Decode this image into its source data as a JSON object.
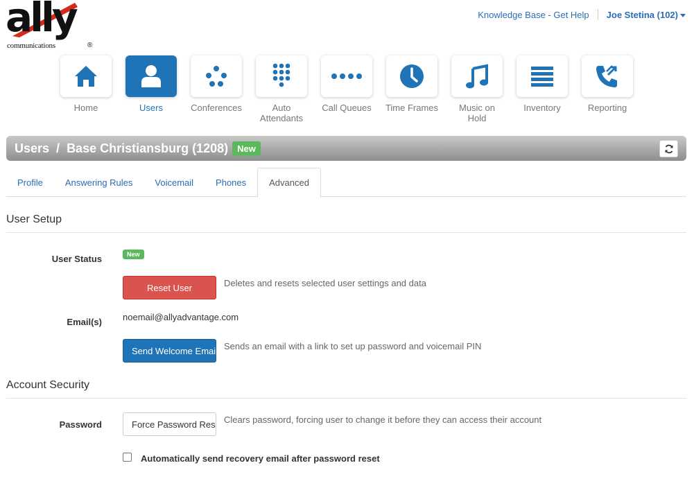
{
  "logo": {
    "main": "ally",
    "sub": "communications",
    "reg": "®"
  },
  "topbar": {
    "kb_link": "Knowledge Base - Get Help",
    "user": "Joe Stetina (102)"
  },
  "nav": [
    {
      "label": "Home",
      "icon": "home-icon"
    },
    {
      "label": "Users",
      "icon": "user-icon"
    },
    {
      "label": "Conferences",
      "icon": "conference-icon"
    },
    {
      "label": "Auto\nAttendants",
      "icon": "keypad-icon"
    },
    {
      "label": "Call Queues",
      "icon": "dots-icon"
    },
    {
      "label": "Time Frames",
      "icon": "clock-icon"
    },
    {
      "label": "Music on\nHold",
      "icon": "music-icon"
    },
    {
      "label": "Inventory",
      "icon": "list-icon"
    },
    {
      "label": "Reporting",
      "icon": "phone-report-icon"
    }
  ],
  "titlebar": {
    "section": "Users",
    "separator": "/",
    "name": "Base Christiansburg (1208)",
    "badge": "New"
  },
  "tabs": [
    "Profile",
    "Answering Rules",
    "Voicemail",
    "Phones",
    "Advanced"
  ],
  "user_setup": {
    "title": "User Setup",
    "status_label": "User Status",
    "status_badge": "New",
    "reset_button": "Reset User",
    "reset_help": "Deletes and resets selected user settings and data",
    "email_label": "Email(s)",
    "email_value": "noemail@allyadvantage.com",
    "welcome_button": "Send Welcome Email",
    "welcome_help": "Sends an email with a link to set up password and voicemail PIN"
  },
  "account_security": {
    "title": "Account Security",
    "password_label": "Password",
    "force_button": "Force Password Reset",
    "force_help": "Clears password, forcing user to change it before they can access their account",
    "checkbox_label": "Automatically send recovery email after password reset"
  },
  "colors": {
    "accent": "#1f73b7",
    "danger": "#d9534f",
    "success": "#5cb85c",
    "link": "#2a6db5"
  }
}
